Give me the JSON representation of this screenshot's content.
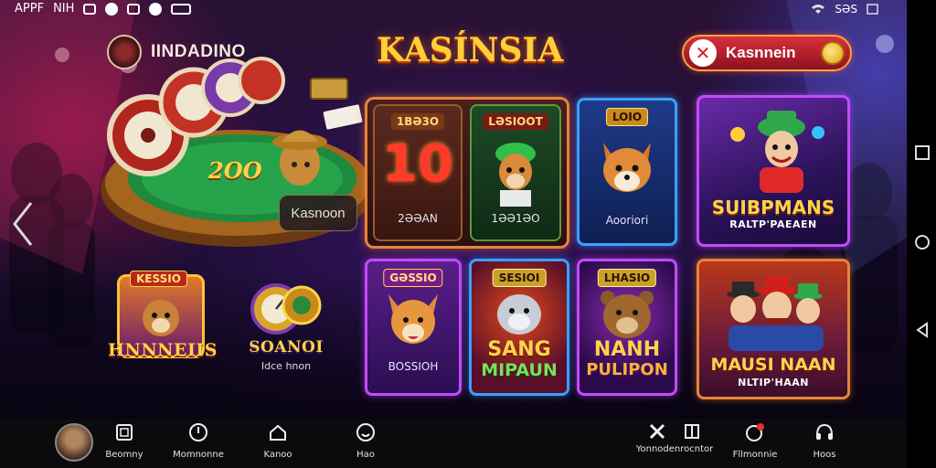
{
  "status_bar": {
    "left_text_1": "APPF",
    "left_text_2": "ΝΙΗ",
    "right_text": "SƏS"
  },
  "header": {
    "brand_name": "IINDADINO",
    "title": "KASÍNSIA",
    "login_button_label": "Kasnnein"
  },
  "featured_table": {
    "score": "2OO",
    "label": "Kasnoon"
  },
  "tiles": [
    {
      "badge": "1BƏ3O",
      "big": "10",
      "caption": "2ƏƏAN"
    },
    {
      "badge": "LƏSIOOT",
      "caption": "1ƏƏ1ƏO"
    },
    {
      "badge": "LOIO",
      "caption": "Aooriori"
    },
    {
      "title": "SUIBPMANS",
      "subtitle": "RALTP'PAEAEN"
    },
    {
      "badge": "KESSIO",
      "title": "HNNNEIIS"
    },
    {
      "title": "SOANOI",
      "caption": "Idce hnon"
    },
    {
      "badge": "GƏSSIO",
      "caption": "BOSSIOH"
    },
    {
      "badge": "SESIOI",
      "title_1": "SANG",
      "title_2": "MIPAUN"
    },
    {
      "badge": "LHASIO",
      "title_1": "NANH",
      "title_2": "PULIPON"
    },
    {
      "title": "MAUSI NAAN",
      "subtitle": "NLTIP'HAAN"
    }
  ],
  "bottom_nav": [
    {
      "label": "Beomny",
      "icon": "tablet-icon"
    },
    {
      "label": "Momnonne",
      "icon": "compass-icon"
    },
    {
      "label": "Kanoo",
      "icon": "home-icon"
    },
    {
      "label": "Hao",
      "icon": "smile-icon"
    },
    {
      "label": "Yonnodenrocntor",
      "icon": "tools-icon"
    },
    {
      "label": "Fllmonnie",
      "icon": "notification-icon"
    },
    {
      "label": "Hoos",
      "icon": "headset-icon"
    }
  ],
  "colors": {
    "title_gold": "#ffcf3a",
    "login_red": "#d8303a",
    "tile_orange_border": "#e7833a",
    "tile_blue_border": "#3aa0ff",
    "tile_purple_border": "#c24bff"
  }
}
